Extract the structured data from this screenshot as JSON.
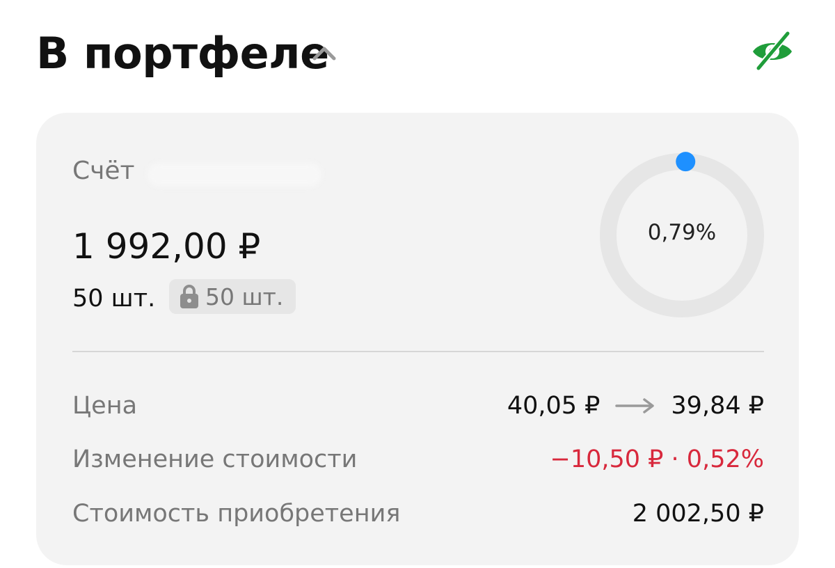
{
  "header": {
    "title": "В портфеле"
  },
  "card": {
    "account_label": "Счёт",
    "value": "1 992,00 ₽",
    "quantity": "50 шт.",
    "locked_quantity": "50 шт.",
    "allocation_percent_label": "0,79%",
    "allocation_fraction": 0.0079,
    "accent_color": "#1e90ff",
    "rows": [
      {
        "label": "Цена",
        "from": "40,05 ₽",
        "to": "39,84 ₽"
      },
      {
        "label": "Изменение стоимости",
        "value": "−10,50 ₽ · 0,52%",
        "color": "#d8283c"
      },
      {
        "label": "Стоимость приобретения",
        "value": "2 002,50 ₽"
      }
    ]
  },
  "icons": {
    "collapse": "chevron-up-icon",
    "visibility": "eye-off-icon",
    "lock": "lock-icon",
    "arrow": "arrow-right-icon"
  },
  "colors": {
    "eye_icon": "#1f9d3a",
    "card_bg": "#f3f3f3",
    "negative": "#d8283c"
  }
}
